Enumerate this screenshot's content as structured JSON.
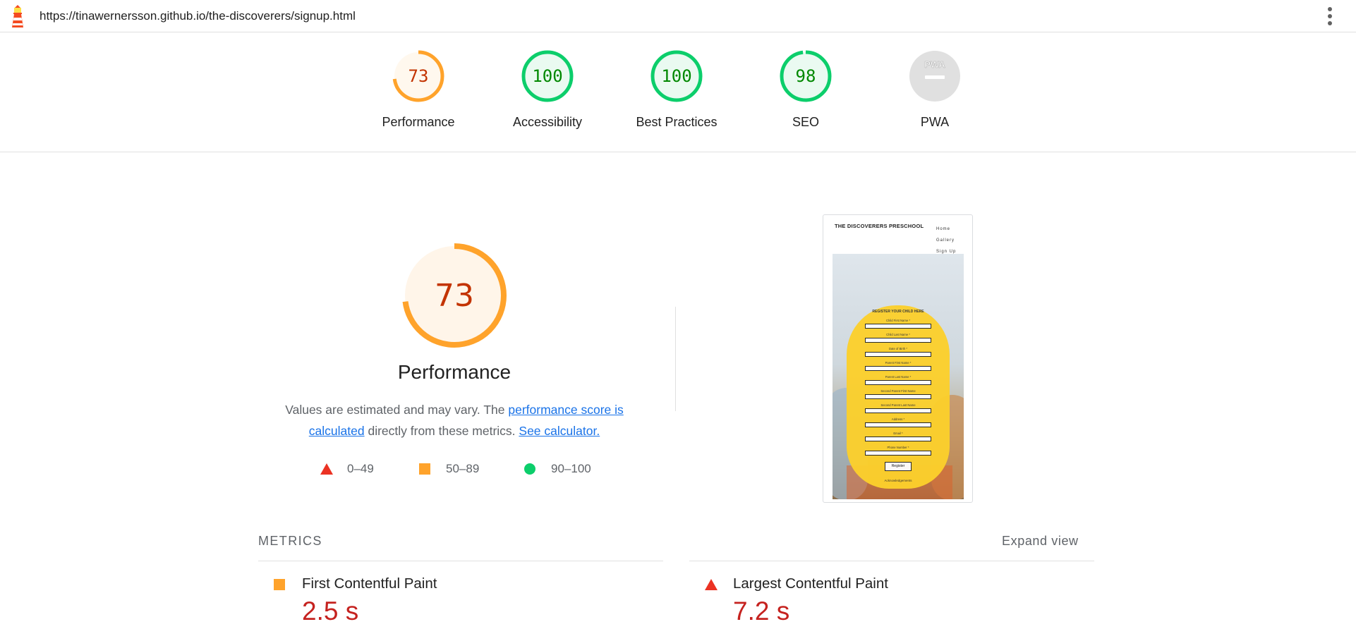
{
  "page": {
    "url": "https://tinawernersson.github.io/the-discoverers/signup.html"
  },
  "categories": [
    {
      "name": "Performance",
      "score": "73",
      "value": 0.73,
      "status": "average"
    },
    {
      "name": "Accessibility",
      "score": "100",
      "value": 1.0,
      "status": "pass"
    },
    {
      "name": "Best Practices",
      "score": "100",
      "value": 1.0,
      "status": "pass"
    },
    {
      "name": "SEO",
      "score": "98",
      "value": 0.98,
      "status": "pass"
    },
    {
      "name": "PWA",
      "score": "",
      "status": "na",
      "badge": "PWA"
    }
  ],
  "performance": {
    "score": "73",
    "value": 0.73,
    "title": "Performance",
    "desc_prefix": "Values are estimated and may vary. The ",
    "link_score": "performance score is calculated",
    "desc_middle": " directly from these metrics. ",
    "link_calculator": "See calculator."
  },
  "legend": [
    {
      "range": "0–49",
      "shape": "triangle",
      "color": "#eb3223"
    },
    {
      "range": "50–89",
      "shape": "square",
      "color": "#ffa32b"
    },
    {
      "range": "90–100",
      "shape": "circle",
      "color": "#0cce6b"
    }
  ],
  "screenshot": {
    "site_title": "THE DISCOVERERS PRESCHOOL",
    "nav": [
      "Home",
      "Gallery",
      "Sign Up"
    ],
    "form_heading": "REGISTER YOUR CHILD HERE",
    "fields": [
      "Child First Name *",
      "Child Last Name *",
      "Date of Birth *",
      "Parent First Name *",
      "Parent Last Name *",
      "Second Parent First Name",
      "Second Parent Last Name",
      "Address *",
      "Email *",
      "Phone Number *"
    ],
    "button": "Register",
    "footer_link": "Acknowledgements"
  },
  "metrics": {
    "header": "METRICS",
    "expand": "Expand view",
    "items": [
      {
        "name": "First Contentful Paint",
        "value": "2.5 s",
        "status": "average"
      },
      {
        "name": "Largest Contentful Paint",
        "value": "7.2 s",
        "status": "fail"
      }
    ]
  },
  "colors": {
    "pass": "#0cce6b",
    "average": "#ffa32b",
    "fail": "#eb3223",
    "link": "#1a73e8"
  }
}
